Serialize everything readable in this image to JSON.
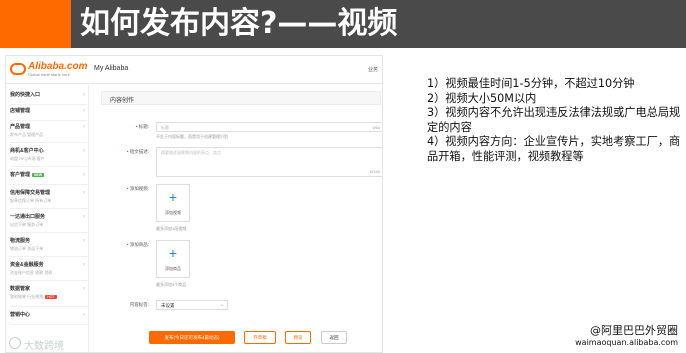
{
  "slide": {
    "title": "如何发布内容?——视频",
    "notes": [
      "1）视频最佳时间1-5分钟，不超过10分钟",
      "2）视频大小50M以内",
      "3）视频内容不允许出现违反法律法规或广电总局规定的内容",
      "4）视频内容方向：企业宣传片，实地考察工厂，商品开箱，性能评测，视频教程等"
    ],
    "credit_handle": "@阿里巴巴外贸圈",
    "credit_site": "waimaoquan.alibaba.com",
    "watermark": "大数跨境"
  },
  "app": {
    "logo": "Alibaba.com",
    "logo_tagline": "Global trade starts here",
    "header_title": "My Alibaba",
    "header_right": "业务",
    "accent_color": "#ff6a00"
  },
  "sidebar": {
    "items": [
      {
        "label": "我的快捷入口",
        "sub": ""
      },
      {
        "label": "店铺管理",
        "sub": ""
      },
      {
        "label": "产品管理",
        "sub": "发布产品  管理产品"
      },
      {
        "label": "商机&客户中心",
        "sub": "询盘  RFQ市场  客户"
      },
      {
        "label": "客户管理",
        "badge": "NEW",
        "sub": ""
      },
      {
        "label": "信用保障交易管理",
        "sub": "起草信保订单  所有订单"
      },
      {
        "label": "一达通出口服务",
        "sub": "出货下单  服务订单"
      },
      {
        "label": "物流服务",
        "sub": "物流订单  承运下单"
      },
      {
        "label": "资金&金融服务",
        "sub": "资金账户信息  收款  贷款"
      },
      {
        "label": "数据管家",
        "sub": "我的效果  行业视角",
        "badge_hot": "HOT"
      },
      {
        "label": "营销中心",
        "sub": ""
      }
    ]
  },
  "form": {
    "section_title": "内容创作",
    "title_label": "标题",
    "title_placeholder": "标题",
    "title_count": "0/64",
    "title_hint": "不乱于内容标题，而是用于创建管理识别",
    "desc_label": "短文描述",
    "desc_placeholder": "简要描述该视频内容的亮点、卖点",
    "desc_count": "0/140",
    "video_label": "添加视频",
    "video_upload": "添加视频",
    "video_hint": "最多添加1段视频",
    "product_label": "添加商品",
    "product_upload": "添加商品",
    "product_hint": "最多添加3个商品",
    "tag_label": "内容标签",
    "tag_value": "未设置",
    "publish_button": "发布(今日还可发布4篇动态)",
    "draft_button": "存草稿",
    "preview_button": "预览",
    "back_button": "返回"
  }
}
